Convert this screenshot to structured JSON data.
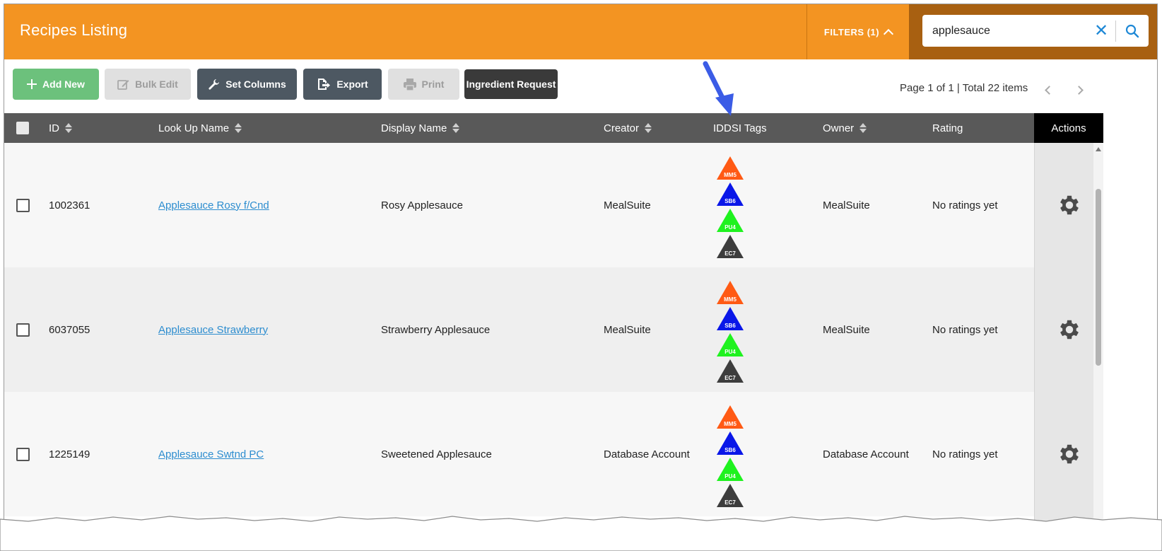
{
  "header": {
    "title": "Recipes Listing",
    "filters_label": "FILTERS (1)",
    "search_value": "applesauce",
    "clear_icon": "✕"
  },
  "toolbar": {
    "add_new": "Add New",
    "bulk_edit": "Bulk Edit",
    "set_columns": "Set Columns",
    "export": "Export",
    "print": "Print",
    "ingredient_request": "Ingredient Request",
    "paging": "Page 1 of 1 | Total 22 items"
  },
  "columns": {
    "id": "ID",
    "lookup": "Look Up Name",
    "display": "Display Name",
    "creator": "Creator",
    "iddsi": "IDDSI Tags",
    "owner": "Owner",
    "rating": "Rating",
    "actions": "Actions"
  },
  "tags": [
    {
      "label": "MM5",
      "color": "#ff5a14"
    },
    {
      "label": "SB6",
      "color": "#0a17e8"
    },
    {
      "label": "PU4",
      "color": "#1ff21f"
    },
    {
      "label": "EC7",
      "color": "#3d3d3d"
    }
  ],
  "rows": [
    {
      "id": "1002361",
      "lookup": "Applesauce Rosy f/Cnd",
      "display": "Rosy Applesauce",
      "creator": "MealSuite",
      "owner": "MealSuite",
      "rating": "No ratings yet"
    },
    {
      "id": "6037055",
      "lookup": "Applesauce Strawberry",
      "display": "Strawberry Applesauce",
      "creator": "MealSuite",
      "owner": "MealSuite",
      "rating": "No ratings yet"
    },
    {
      "id": "1225149",
      "lookup": "Applesauce Swtnd PC",
      "display": "Sweetened Applesauce",
      "creator": "Database Account",
      "owner": "Database Account",
      "rating": "No ratings yet"
    }
  ],
  "colors": {
    "header_orange": "#f39422",
    "search_panel": "#a86011",
    "add_green": "#6cc17c",
    "dark_button": "#4d5862",
    "link_blue": "#2d8dcf",
    "annotation_arrow": "#3b5ce6"
  }
}
